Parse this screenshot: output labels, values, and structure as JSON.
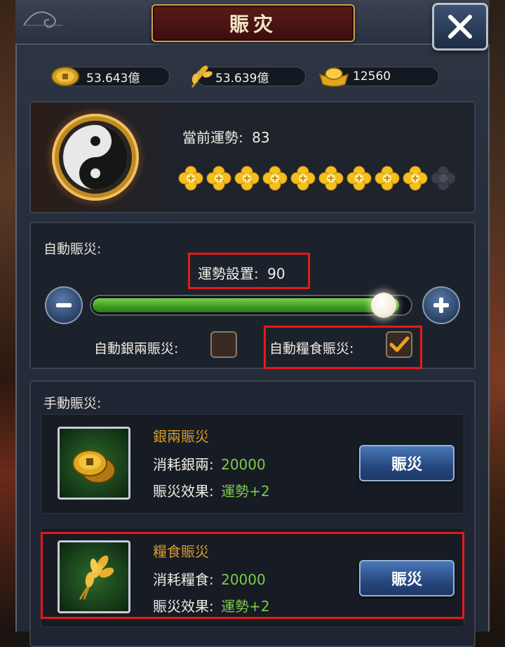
{
  "header": {
    "title": "賑灾"
  },
  "resources": {
    "copper": {
      "value": "53.643億",
      "icon": "copper-coin-icon"
    },
    "grain": {
      "value": "53.639億",
      "icon": "wheat-icon"
    },
    "gold": {
      "value": "12560",
      "icon": "gold-ingot-icon"
    }
  },
  "fortune": {
    "label": "當前運勢:",
    "value": "83",
    "stars_total": 10,
    "stars_filled": 9
  },
  "auto_relief": {
    "label": "自動賑災:",
    "setting_label": "運勢設置:",
    "setting_value": "90",
    "slider_fraction": 0.9,
    "silver_label": "自動銀兩賑災:",
    "silver_checked": false,
    "grain_label": "自動糧食賑災:",
    "grain_checked": true
  },
  "manual_relief": {
    "label": "手動賑災:",
    "cards": [
      {
        "title": "銀兩賑災",
        "cost_label": "消耗銀兩:",
        "cost_value": "20000",
        "effect_label": "賑災效果:",
        "effect_value": "運勢+2",
        "button": "賑災",
        "icon": "copper-coins-icon"
      },
      {
        "title": "糧食賑災",
        "cost_label": "消耗糧食:",
        "cost_value": "20000",
        "effect_label": "賑災效果:",
        "effect_value": "運勢+2",
        "button": "賑災",
        "icon": "wheat-bundle-icon"
      }
    ]
  },
  "colors": {
    "accent_gold": "#d89a2a",
    "value_green": "#7ccc4a",
    "highlight_red": "#e41a1a",
    "slider_green": "#3e9a22"
  }
}
